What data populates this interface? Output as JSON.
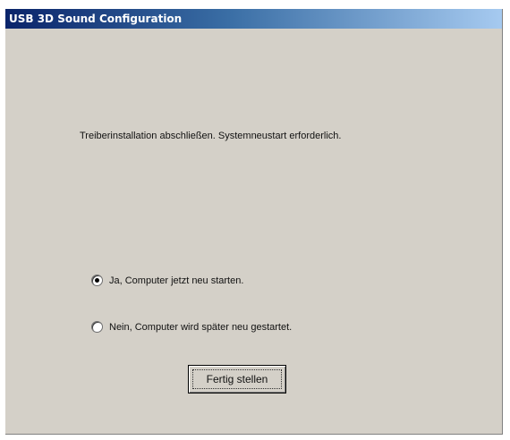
{
  "window": {
    "title": "USB 3D Sound Configuration"
  },
  "message": "Treiberinstallation abschließen. Systemneustart erforderlich.",
  "options": [
    {
      "label": "Ja, Computer jetzt neu starten.",
      "selected": true
    },
    {
      "label": "Nein, Computer wird später neu gestartet.",
      "selected": false
    }
  ],
  "finish_button": {
    "label": "Fertig stellen"
  },
  "colors": {
    "dialog_background": "#d4d0c8",
    "titlebar_start": "#0a246a",
    "titlebar_end": "#a6caf0"
  }
}
